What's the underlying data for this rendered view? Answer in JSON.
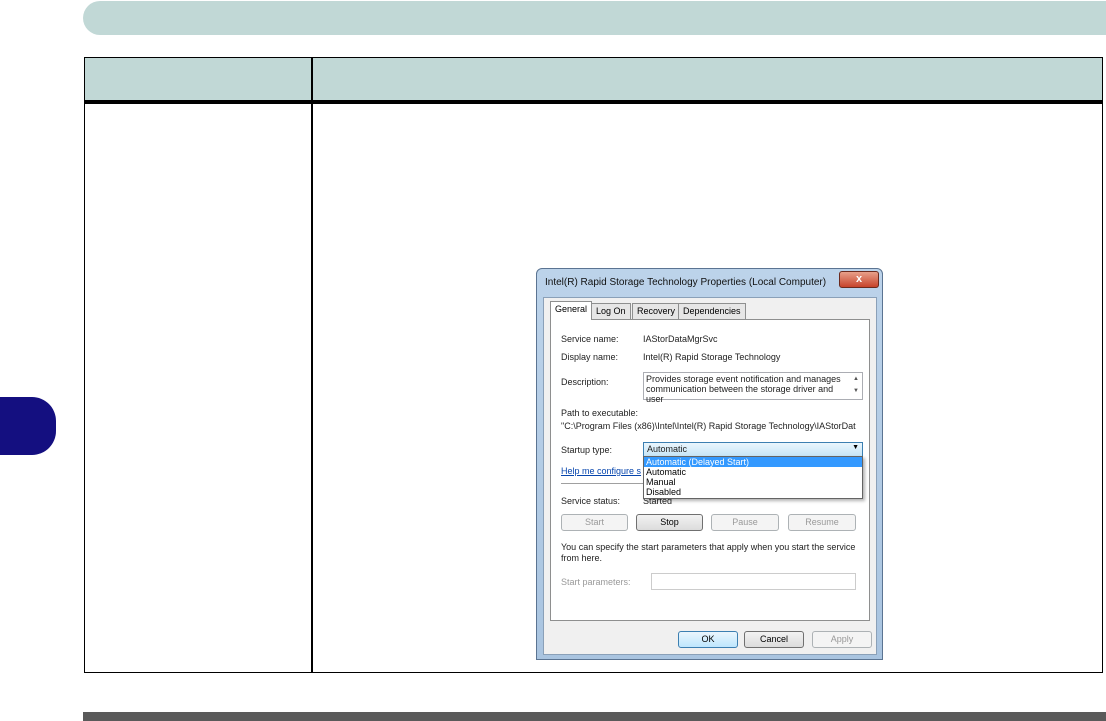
{
  "dialog": {
    "title": "Intel(R) Rapid Storage Technology Properties (Local Computer)",
    "close": "x",
    "tabs": [
      "General",
      "Log On",
      "Recovery",
      "Dependencies"
    ],
    "service_name_label": "Service name:",
    "service_name": "IAStorDataMgrSvc",
    "display_name_label": "Display name:",
    "display_name": "Intel(R) Rapid Storage Technology",
    "description_label": "Description:",
    "description": "Provides storage event notification and manages communication between the storage driver and user",
    "path_label": "Path to executable:",
    "path": "\"C:\\Program Files (x86)\\Intel\\Intel(R) Rapid Storage Technology\\IAStorDat",
    "startup_label": "Startup type:",
    "startup_value": "Automatic",
    "startup_options": [
      "Automatic (Delayed Start)",
      "Automatic",
      "Manual",
      "Disabled"
    ],
    "help_link": "Help me configure s",
    "status_label": "Service status:",
    "status_value": "Started",
    "buttons": {
      "start": "Start",
      "stop": "Stop",
      "pause": "Pause",
      "resume": "Resume"
    },
    "params_note": "You can specify the start parameters that apply when you start the service from here.",
    "params_label": "Start parameters:",
    "params_value": "",
    "ok": "OK",
    "cancel": "Cancel",
    "apply": "Apply"
  },
  "colors": {
    "banner": "#c1d8d6",
    "side_tab": "#140f80",
    "footer": "#5a5a5a"
  }
}
